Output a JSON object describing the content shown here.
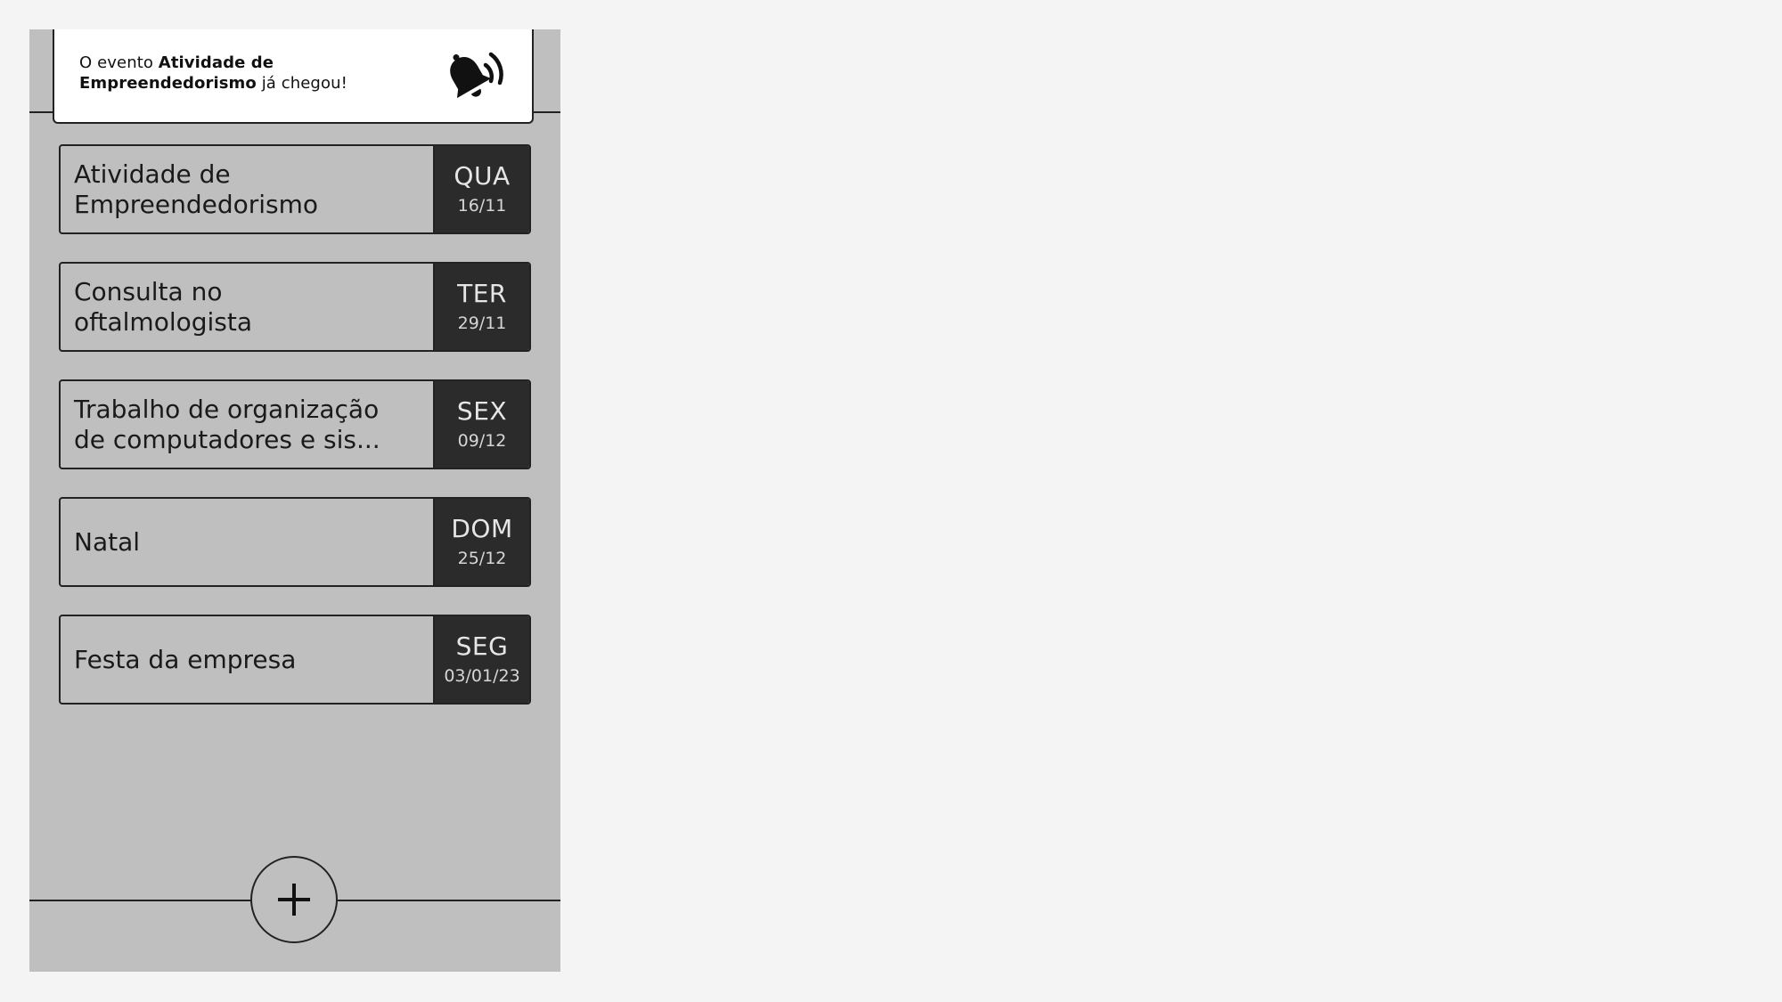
{
  "notification": {
    "prefix": "O evento ",
    "event_name": "Atividade de Empreendedorismo",
    "suffix": " já chegou!",
    "icon": "bell-ringing-icon"
  },
  "events": [
    {
      "title_line1": "Atividade de",
      "title_line2": "Empreendedorismo",
      "day": "QUA",
      "date": "16/11"
    },
    {
      "title_line1": "Consulta no",
      "title_line2": "oftalmologista",
      "day": "TER",
      "date": "29/11"
    },
    {
      "title_line1": "Trabalho de organização",
      "title_line2": "de computadores e sis...",
      "day": "SEX",
      "date": "09/12"
    },
    {
      "title_line1": "Natal",
      "title_line2": "",
      "day": "DOM",
      "date": "25/12"
    },
    {
      "title_line1": "Festa da empresa",
      "title_line2": "",
      "day": "SEG",
      "date": "03/01/23"
    }
  ],
  "add_button": {
    "icon": "plus-icon"
  },
  "colors": {
    "page_background": "#f4f4f4",
    "app_background": "#bfbfbf",
    "date_badge": "#2b2b2b",
    "notification_background": "#ffffff",
    "line": "#222222"
  }
}
